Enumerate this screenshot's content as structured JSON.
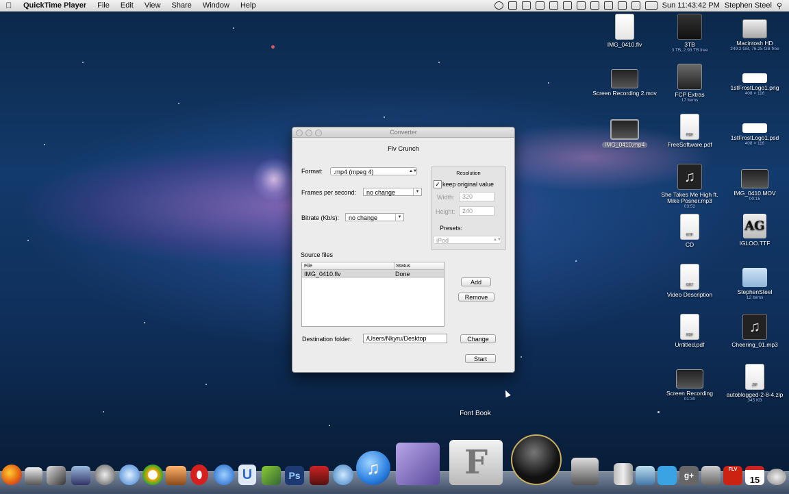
{
  "menubar": {
    "apple": "",
    "app_name": "QuickTime Player",
    "items": [
      "File",
      "Edit",
      "View",
      "Share",
      "Window",
      "Help"
    ],
    "clock": "Sun 11:43:42 PM",
    "user": "Stephen Steel"
  },
  "desktop_icons": [
    {
      "label": "IMG_0410.flv",
      "sub": ""
    },
    {
      "label": "3TB",
      "sub": "3 TB, 2.93 TB free"
    },
    {
      "label": "Macintosh HD",
      "sub": "249.2 GB, 76.25 GB free"
    },
    {
      "label": "Screen Recording 2.mov",
      "sub": ""
    },
    {
      "label": "FCP Extras",
      "sub": "17 items"
    },
    {
      "label": "1stFrostLogo1.png",
      "sub": "408 × 116"
    },
    {
      "label": "IMG_0410.mp4",
      "sub": ""
    },
    {
      "label": "FreeSoftware.pdf",
      "sub": ""
    },
    {
      "label": "1stFrostLogo1.psd",
      "sub": "408 × 116"
    },
    {
      "label": "She Takes Me High ft. Mike Posner.mp3",
      "sub": "03:52"
    },
    {
      "label": "IMG_0410.MOV",
      "sub": "00:15"
    },
    {
      "label": "CD",
      "sub": ""
    },
    {
      "label": "IGLOO.TTF",
      "sub": ""
    },
    {
      "label": "Video Description",
      "sub": ""
    },
    {
      "label": "StephenSteel",
      "sub": "12 items"
    },
    {
      "label": "Untitled.pdf",
      "sub": ""
    },
    {
      "label": "Cheering_01.mp3",
      "sub": ""
    },
    {
      "label": "Screen Recording",
      "sub": "01:30"
    },
    {
      "label": "autoblogged-2-8-4.zip",
      "sub": "345 KB"
    }
  ],
  "doc_badges": {
    "pdf": "PDF",
    "rtf": "RTF",
    "odt": "ODT",
    "zip": "ZIP",
    "font": "AG"
  },
  "window": {
    "title": "Converter",
    "heading": "Flv Crunch",
    "format_label": "Format:",
    "format_value": ".mp4 (mpeg 4)",
    "fps_label": "Frames per second:",
    "fps_value": "no change",
    "bitrate_label": "Bitrate (Kb/s):",
    "bitrate_value": "no change",
    "resolution": {
      "title": "Resolution",
      "keep_original": "keep original value",
      "keep_checked": true,
      "width_label": "Width:",
      "width_value": "320",
      "height_label": "Height:",
      "height_value": "240",
      "presets_label": "Presets:",
      "presets_value": "iPod"
    },
    "source_label": "Source files",
    "table": {
      "columns": [
        "File",
        "Status"
      ],
      "rows": [
        {
          "file": "IMG_0410.flv",
          "status": "Done"
        }
      ]
    },
    "add_button": "Add",
    "remove_button": "Remove",
    "destination_label": "Destination folder:",
    "destination_value": "/Users/Nkyru/Desktop",
    "change_button": "Change",
    "start_button": "Start"
  },
  "dock": {
    "tooltip": "Font Book",
    "calendar_day": "15",
    "badge_flv": "FLV"
  },
  "colors": {
    "selection": "#d8d8d8",
    "menubar": "#e6e6e6",
    "itunes": "#2a7fe0",
    "opera": "#d62020",
    "ps": "#1d3b72"
  }
}
